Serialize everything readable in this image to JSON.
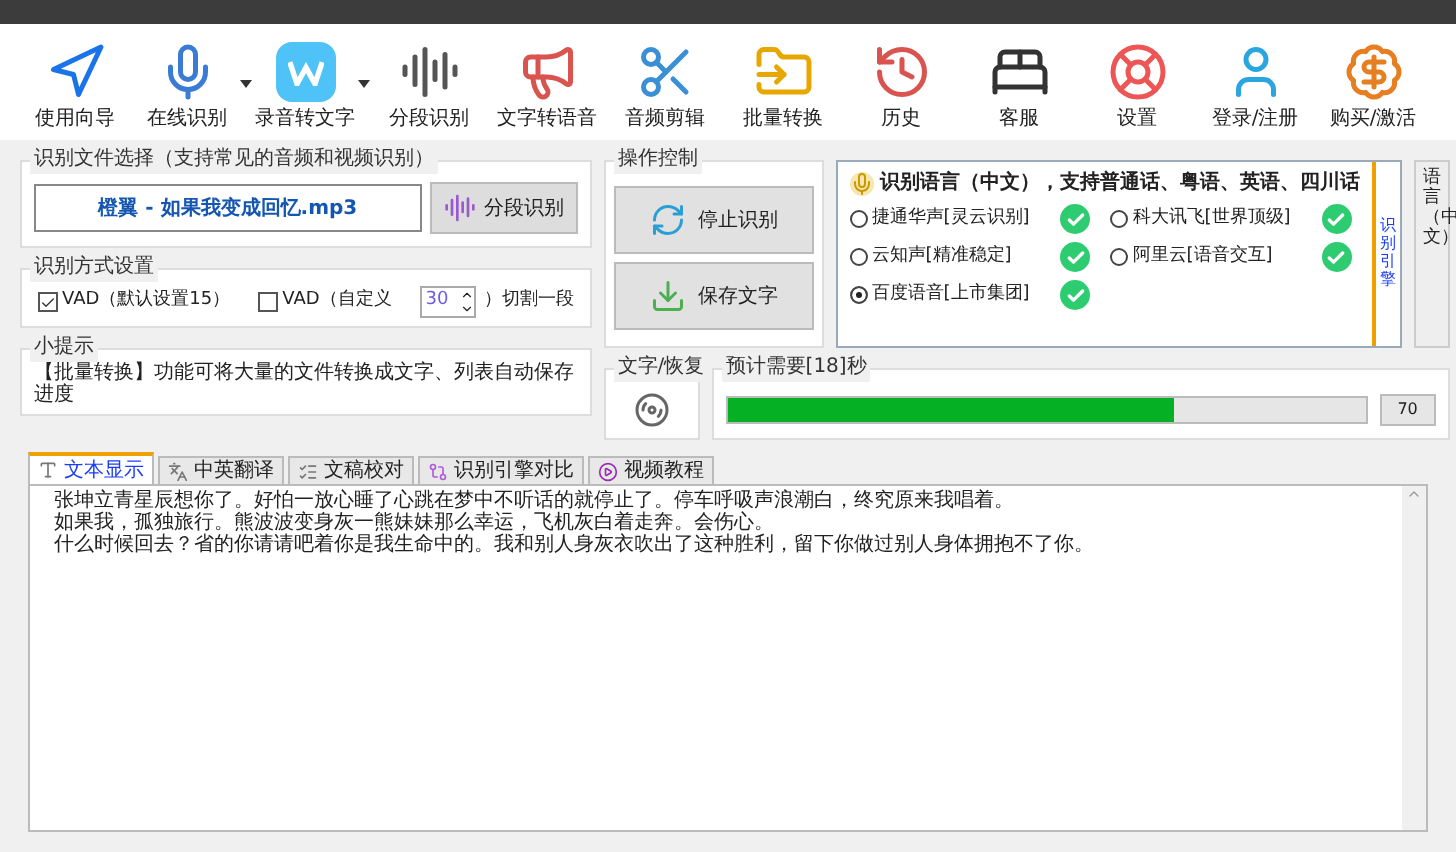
{
  "toolbar": [
    {
      "label": "使用向导",
      "kind": "plain"
    },
    {
      "label": "在线识别",
      "kind": "dropdown"
    },
    {
      "label": "录音转文字",
      "kind": "dropdown"
    },
    {
      "label": "分段识别",
      "kind": "plain"
    },
    {
      "label": "文字转语音",
      "kind": "plain"
    },
    {
      "label": "音频剪辑",
      "kind": "plain"
    },
    {
      "label": "批量转换",
      "kind": "plain"
    },
    {
      "label": "历史",
      "kind": "plain"
    },
    {
      "label": "客服",
      "kind": "plain"
    },
    {
      "label": "设置",
      "kind": "plain"
    },
    {
      "label": "登录/注册",
      "kind": "plain"
    },
    {
      "label": "购买/激活",
      "kind": "plain"
    }
  ],
  "file_select": {
    "title": "识别文件选择（支持常见的音频和视频识别）",
    "file": "橙翼 - 如果我变成回忆.mp3",
    "button": "分段识别"
  },
  "mode": {
    "title": "识别方式设置",
    "options": [
      {
        "label": "VAD（默认设置15）",
        "checked": true
      },
      {
        "label": "VAD（自定义",
        "checked": false
      }
    ],
    "value": "30",
    "suffix": "）切割一段"
  },
  "tip": {
    "title": "小提示",
    "text": "【批量转换】功能可将大量的文件转换成文字、列表自动保存进度"
  },
  "control": {
    "title": "操作控制",
    "buttons": [
      "停止识别",
      "保存文字"
    ]
  },
  "language": {
    "title": "识别语言（中文），支持普通话、粤语、英语、四川话",
    "engines": [
      {
        "label": "捷通华声[灵云识别]",
        "selected": false
      },
      {
        "label": "科大讯飞[世界顶级]",
        "selected": false
      },
      {
        "label": "云知声[精准稳定]",
        "selected": false
      },
      {
        "label": "阿里云[语音交互]",
        "selected": false
      },
      {
        "label": "百度语音[上市集团]",
        "selected": true
      }
    ],
    "side_link": "识别引擎",
    "side_tab": "语言（中文）"
  },
  "restore": {
    "title": "文字/恢复"
  },
  "progress": {
    "title": "预计需要[18]秒",
    "level": 0.7,
    "value": "70"
  },
  "tabs": [
    {
      "label": "文本显示",
      "selected": true
    },
    {
      "label": "中英翻译",
      "selected": false
    },
    {
      "label": "文稿校对",
      "selected": false
    },
    {
      "label": "识别引擎对比",
      "selected": false
    },
    {
      "label": "视频教程",
      "selected": false
    }
  ],
  "text": [
    "张坤立青星辰想你了。好怕一放心睡了心跳在梦中不听话的就停止了。停车呼吸声浪潮白，终究原来我唱着。",
    "如果我，孤独旅行。熊波波变身灰一熊妹妹那么幸运，飞机灰白着走奔。会伤心。",
    "什么时候回去？省的你请请吧着你是我生命中的。我和别人身灰衣吹出了这种胜利，留下你做过别人身体拥抱不了你。"
  ]
}
